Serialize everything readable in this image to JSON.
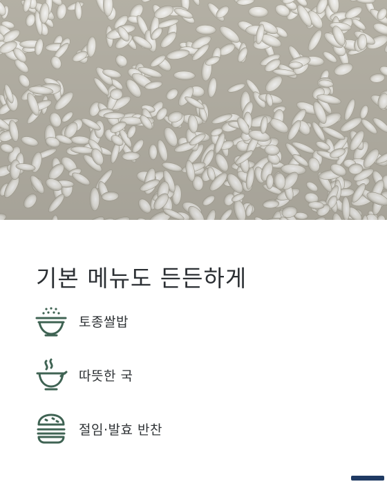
{
  "headline": "기본 메뉴도 든든하게",
  "menu_items": [
    {
      "icon": "rice-bowl-icon",
      "label": "토종쌀밥"
    },
    {
      "icon": "soup-bowl-icon",
      "label": "따뜻한 국"
    },
    {
      "icon": "burger-icon",
      "label": "절임·발효 반찬"
    }
  ],
  "colors": {
    "text": "#2b2f33",
    "icon_green": "#3f6353",
    "hero_base": "#c9c6bb",
    "watermark": "#1f3a63"
  }
}
